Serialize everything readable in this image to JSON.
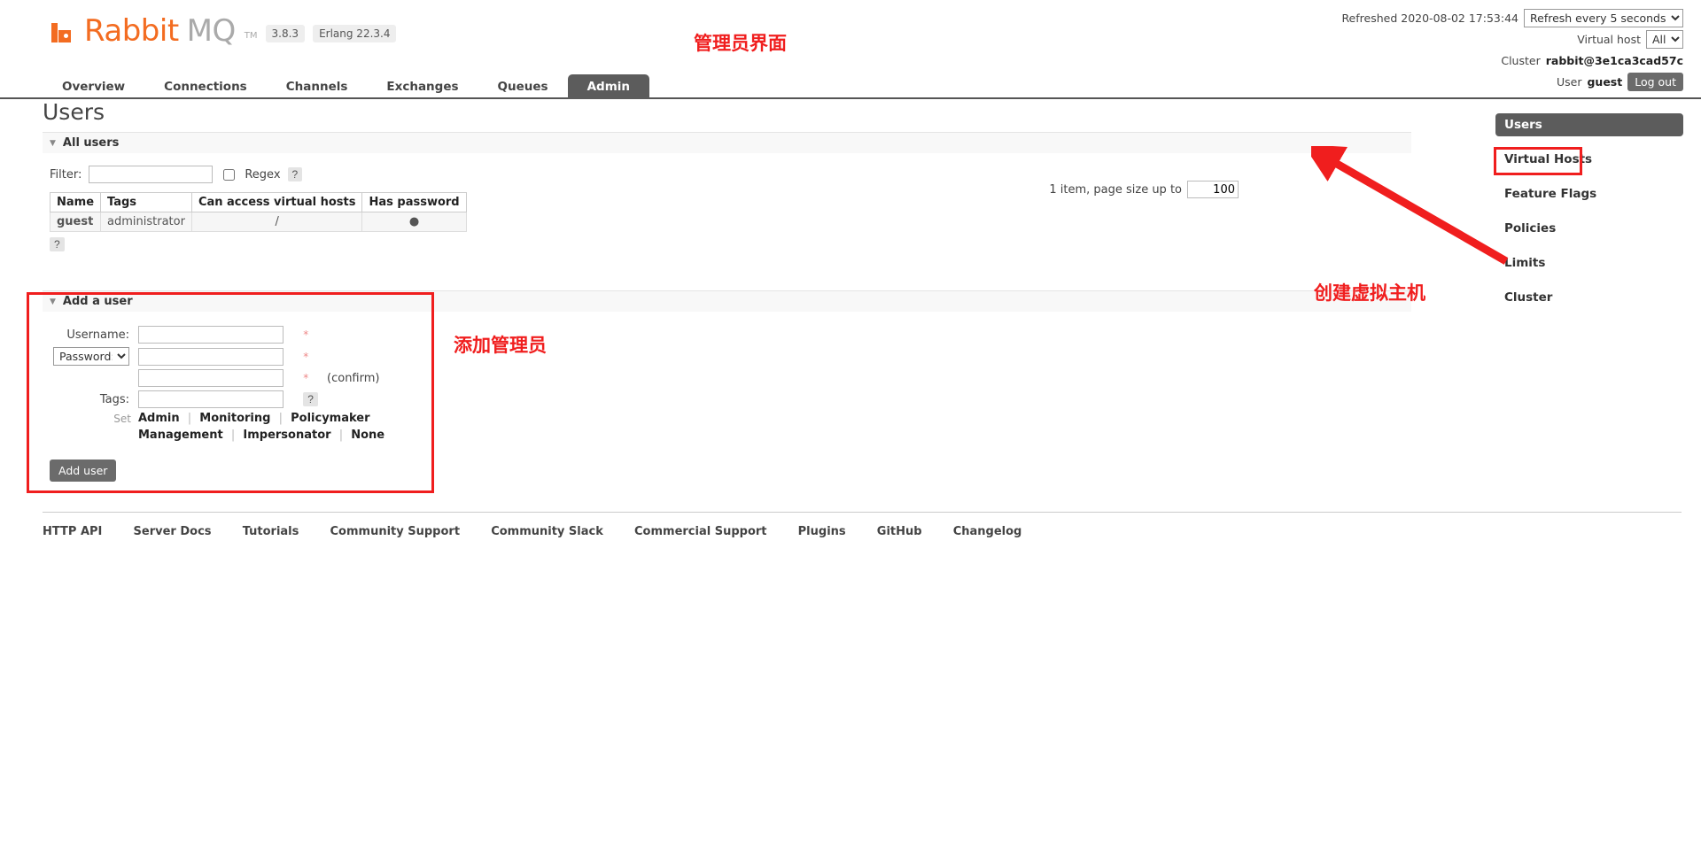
{
  "brand": {
    "name_bold": "Rabbit",
    "name_light": "MQ",
    "tm": "TM",
    "version": "3.8.3",
    "erlang": "Erlang 22.3.4",
    "accent_color": "#f36c21"
  },
  "header": {
    "refreshed_label": "Refreshed 2020-08-02 17:53:44",
    "refresh_interval": "Refresh every 5 seconds",
    "vhost_label": "Virtual host",
    "vhost_value": "All",
    "cluster_label": "Cluster",
    "cluster_name": "rabbit@3e1ca3cad57c",
    "user_label": "User",
    "user_name": "guest",
    "logout_label": "Log out"
  },
  "nav": {
    "tabs": [
      {
        "label": "Overview",
        "active": false
      },
      {
        "label": "Connections",
        "active": false
      },
      {
        "label": "Channels",
        "active": false
      },
      {
        "label": "Exchanges",
        "active": false
      },
      {
        "label": "Queues",
        "active": false
      },
      {
        "label": "Admin",
        "active": true
      }
    ]
  },
  "main": {
    "page_title": "Users",
    "all_users_section": "All users",
    "filter_label": "Filter:",
    "filter_value": "",
    "regex_label": "Regex",
    "help_glyph": "?",
    "pager_text": "1 item, page size up to",
    "page_size": "100",
    "table": {
      "columns": [
        "Name",
        "Tags",
        "Can access virtual hosts",
        "Has password"
      ],
      "rows": [
        {
          "name": "guest",
          "tags": "administrator",
          "vhosts": "/",
          "has_password": "●"
        }
      ]
    }
  },
  "add_user": {
    "section_title": "Add a user",
    "username_label": "Username:",
    "username_value": "",
    "password_label": "Password:",
    "password_value": "",
    "password_confirm_value": "",
    "confirm_note": "(confirm)",
    "tags_label": "Tags:",
    "tags_value": "",
    "required_mark": "*",
    "set_label": "Set",
    "tag_presets": [
      "Admin",
      "Monitoring",
      "Policymaker",
      "Management",
      "Impersonator",
      "None"
    ],
    "submit_label": "Add user"
  },
  "sidebar": {
    "items": [
      {
        "label": "Users",
        "active": true
      },
      {
        "label": "Virtual Hosts",
        "active": false
      },
      {
        "label": "Feature Flags",
        "active": false
      },
      {
        "label": "Policies",
        "active": false
      },
      {
        "label": "Limits",
        "active": false
      },
      {
        "label": "Cluster",
        "active": false
      }
    ]
  },
  "footer": {
    "links": [
      "HTTP API",
      "Server Docs",
      "Tutorials",
      "Community Support",
      "Community Slack",
      "Commercial Support",
      "Plugins",
      "GitHub",
      "Changelog"
    ]
  },
  "annotations": {
    "color": "#f01e1e",
    "admin_interface": "管理员界面",
    "add_admin": "添加管理员",
    "create_vhost": "创建虚拟主机"
  }
}
